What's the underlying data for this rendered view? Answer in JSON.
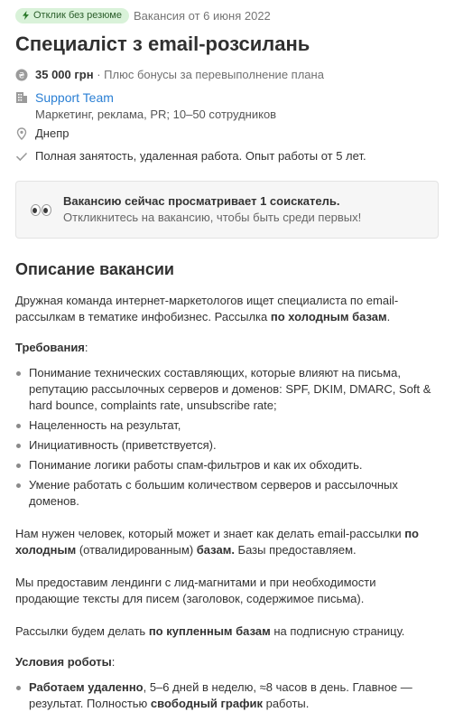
{
  "badge": {
    "label": "Отклик без резюме"
  },
  "posted": "Вакансия от 6 июня 2022",
  "title": "Специаліст з email-розсилань",
  "salary": {
    "amount": "35 000 грн",
    "note": "· Плюс бонусы за перевыполнение плана"
  },
  "company": {
    "name": "Support Team",
    "details": "Маркетинг, реклама, PR; 10–50 сотрудников"
  },
  "location": "Днепр",
  "employment": "Полная занятость, удаленная работа. Опыт работы от 5 лет.",
  "notice": {
    "title": "Вакансию сейчас просматривает 1 соискатель.",
    "subtitle": "Откликнитесь на вакансию, чтобы быть среди первых!"
  },
  "description": {
    "heading": "Описание вакансии",
    "intro_a": "Дружная команда интернет-маркетологов ищет специалиста по email-рассылкам в тематике инфобизнес. Рассылка ",
    "intro_b": "по холодным базам",
    "intro_c": ".",
    "requirements_label": "Требования",
    "requirements_colon": ":",
    "requirements": [
      "Понимание технических составляющих, которые влияют на письма, репутацию рассылочных серверов и доменов: SPF, DKIM, DMARC, Soft & hard bounce, complaints rate, unsubscribe rate;",
      "Нацеленность на результат,",
      "Инициативность (приветствуется).",
      "Понимание логики работы спам-фильтров и как их обходить.",
      "Умение работать с большим количеством серверов и рассылочных доменов."
    ],
    "p2_a": "Нам нужен человек, который может и знает как делать email-рассылки ",
    "p2_b": "по холодным",
    "p2_c": " (отвалидированным) ",
    "p2_d": "базам.",
    "p2_e": " Базы предоставляем.",
    "p3": "Мы предоставим лендинги с лид-магнитами и при необходимости продающие тексты для писем (заголовок, содержимое письма).",
    "p4_a": "Рассылки будем делать ",
    "p4_b": "по купленным базам",
    "p4_c": " на подписную страницу.",
    "conditions_label": "Условия роботы",
    "conditions_colon": ":",
    "cond1_a": "Работаем удаленно",
    "cond1_b": ", 5–6 дней в неделю, ≈8 часов в день. Главное — результат. Полностью ",
    "cond1_c": "свободный график",
    "cond1_d": " работы."
  }
}
